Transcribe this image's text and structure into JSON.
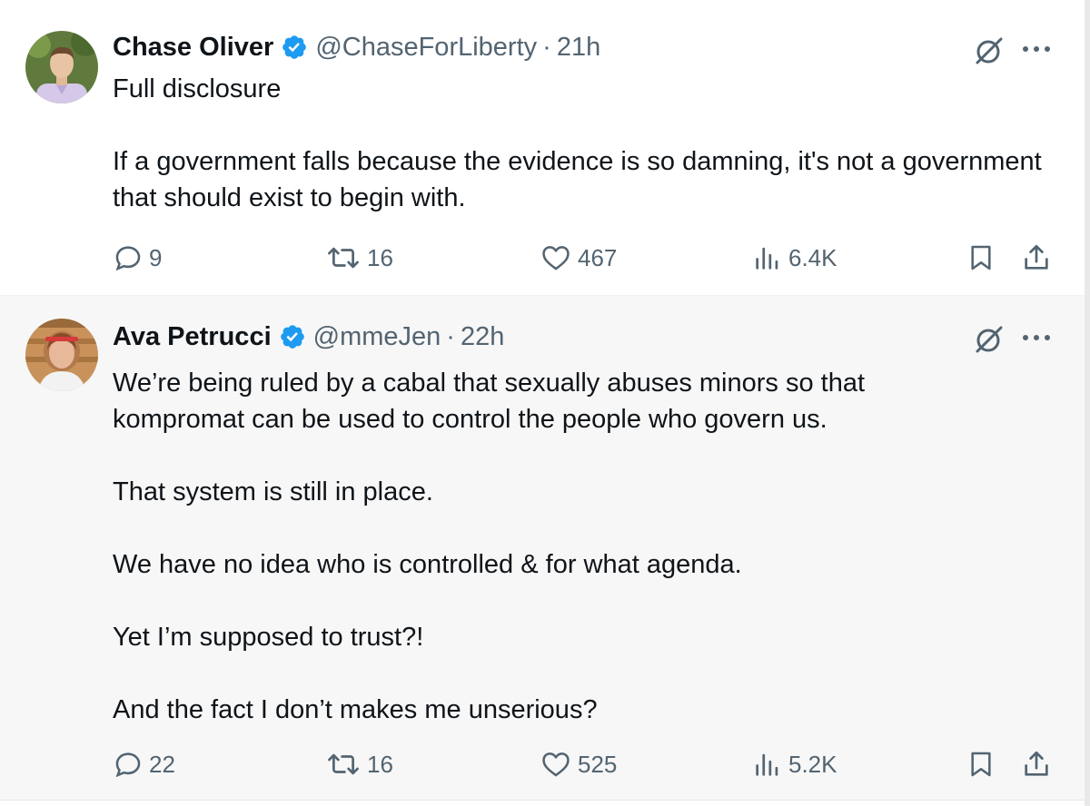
{
  "tweets": [
    {
      "author": "Chase Oliver",
      "handle": "@ChaseForLiberty",
      "separator": "·",
      "time": "21h",
      "avatar_icon": "user-avatar",
      "paragraphs": [
        "Full disclosure",
        "If a government falls because the evidence is so damning, it's not a government that should exist to begin with."
      ],
      "stats": {
        "replies": "9",
        "reposts": "16",
        "likes": "467",
        "views": "6.4K"
      }
    },
    {
      "author": "Ava Petrucci",
      "handle": "@mmeJen",
      "separator": "·",
      "time": "22h",
      "avatar_icon": "user-avatar",
      "paragraphs": [
        "We’re being ruled by a cabal that sexually abuses minors so that kompromat can be used to control the people who govern us.",
        "That system is still in place.",
        "We have no idea who is controlled & for what agenda.",
        "Yet I’m supposed to trust?!",
        "And the fact I don’t makes me unserious?"
      ],
      "stats": {
        "replies": "22",
        "reposts": "16",
        "likes": "525",
        "views": "5.2K"
      }
    }
  ],
  "colors": {
    "verified_blue": "#1d9bf0",
    "text_primary": "#0f1419",
    "text_secondary": "#536471",
    "tweet2_background": "#f7f7f7"
  }
}
